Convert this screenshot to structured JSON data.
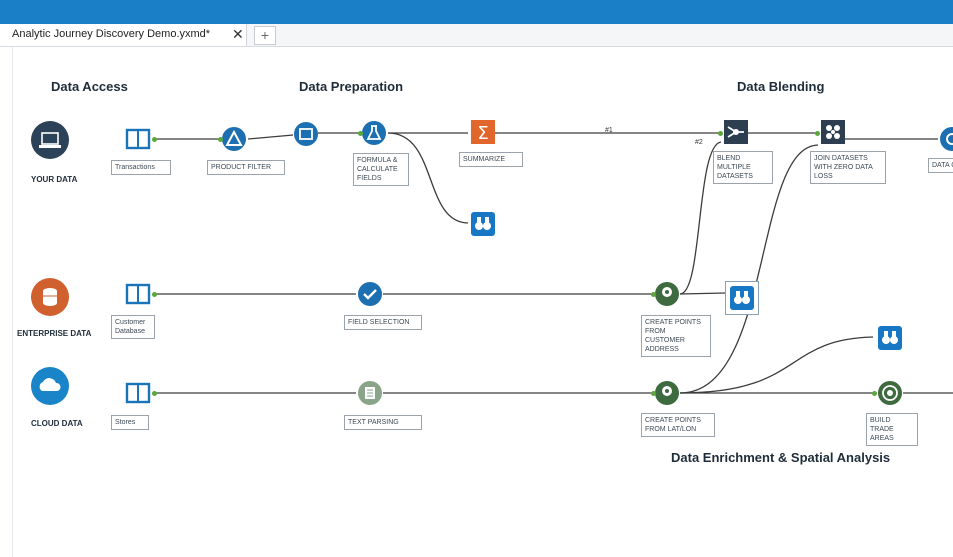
{
  "window": {
    "tab_title": "Analytic Journey Discovery Demo.yxmd*",
    "tab_close": "✕",
    "tab_add": "+"
  },
  "colors": {
    "topbar": "#1a7fc7",
    "input_blue": "#1a74b8",
    "prep_blue": "#1c6fb0",
    "join_dark": "#2c3e50",
    "output_blue": "#1877c5",
    "spatial_green": "#3d6b3f",
    "summarize_orange": "#e0662b",
    "enterprise_orange": "#d0612f",
    "cloud_blue": "#1a84c8",
    "your_data_dark": "#2b4258"
  },
  "headings": {
    "data_access": "Data Access",
    "data_preparation": "Data Preparation",
    "data_blending": "Data Blending",
    "enrichment": "Data Enrichment & Spatial Analysis"
  },
  "sources": {
    "your_data": "YOUR DATA",
    "enterprise": "ENTERPRISE DATA",
    "cloud": "CLOUD DATA"
  },
  "tools": {
    "transactions": "Transactions",
    "product_filter": "PRODUCT FILTER",
    "formula": "FORMULA & CALCULATE FIELDS",
    "summarize": "SUMMARIZE",
    "blend": "BLEND MULTIPLE DATASETS",
    "join": "JOIN DATASETS WITH ZERO DATA LOSS",
    "data_cleanse": "DATA CLEA",
    "customer": "Customer Database",
    "field_selection": "FIELD SELECTION",
    "create_points_customer": "CREATE POINTS FROM CUSTOMER ADDRESS",
    "stores": "Stores",
    "text_parsing": "TEXT PARSING",
    "create_points_latlon": "CREATE POINTS FROM LAT/LON",
    "trade_areas": "BUILD TRADE AREAS"
  },
  "wire_labels": {
    "w1": "#1",
    "w2": "#2"
  },
  "icons": [
    "laptop-icon",
    "database-icon",
    "cloud-icon",
    "book-input-icon",
    "filter-icon",
    "select-icon",
    "formula-icon",
    "summarize-icon",
    "browse-icon",
    "blend-icon",
    "join-icon",
    "cleanse-icon",
    "field-select-icon",
    "create-points-icon",
    "text-parse-icon",
    "trade-area-icon"
  ]
}
